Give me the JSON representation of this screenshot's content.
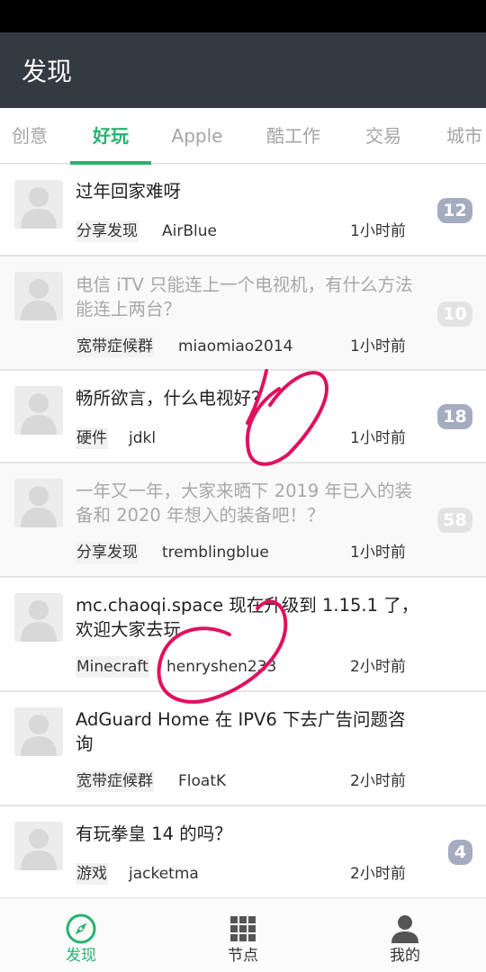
{
  "app_bar": {
    "title": "发现"
  },
  "tabs": [
    {
      "label": "创意"
    },
    {
      "label": "好玩"
    },
    {
      "label": "Apple"
    },
    {
      "label": "酷工作"
    },
    {
      "label": "交易"
    },
    {
      "label": "城市"
    }
  ],
  "topics": [
    {
      "title": "过年回家难呀",
      "node": "分享发现",
      "user": "AirBlue",
      "time": "1小时前",
      "replies": "12",
      "read": false
    },
    {
      "title": "电信 iTV 只能连上一个电视机，有什么方法能连上两台？",
      "node": "宽带症候群",
      "user": "miaomiao2014",
      "time": "1小时前",
      "replies": "10",
      "read": true
    },
    {
      "title": "畅所欲言，什么电视好？",
      "node": "硬件",
      "user": "jdkl",
      "time": "1小时前",
      "replies": "18",
      "read": false
    },
    {
      "title": "一年又一年，大家来晒下 2019 年已入的装备和 2020 年想入的装备吧！？",
      "node": "分享发现",
      "user": "tremblingblue",
      "time": "1小时前",
      "replies": "58",
      "read": true
    },
    {
      "title": "mc.chaoqi.space 现在升级到 1.15.1 了，欢迎大家去玩",
      "node": "Minecraft",
      "user": "henryshen233",
      "time": "2小时前",
      "replies": "",
      "read": false
    },
    {
      "title": "AdGuard Home 在 IPV6 下去广告问题咨询",
      "node": "宽带症候群",
      "user": "FloatK",
      "time": "2小时前",
      "replies": "",
      "read": false
    },
    {
      "title": "有玩拳皇 14 的吗？",
      "node": "游戏",
      "user": "jacketma",
      "time": "2小时前",
      "replies": "4",
      "read": false
    }
  ],
  "bottom_nav": [
    {
      "label": "发现",
      "icon": "compass-icon"
    },
    {
      "label": "节点",
      "icon": "grid-icon"
    },
    {
      "label": "我的",
      "icon": "person-icon"
    }
  ],
  "colors": {
    "accent": "#27b36f",
    "app_bar": "#343a42",
    "badge": "#a4acc0",
    "badge_read": "#e3e3e3",
    "annotation_ink": "#e0115f"
  }
}
